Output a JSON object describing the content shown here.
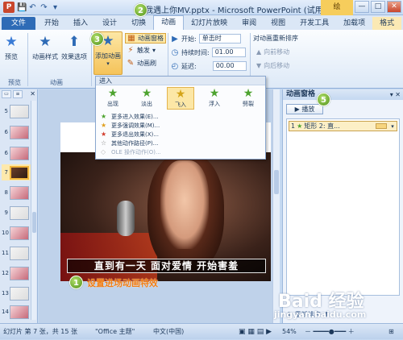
{
  "titlebar": {
    "app_logo": "P",
    "qat": [
      "💾",
      "↶",
      "↷",
      "▾"
    ],
    "title": "当我遇上你MV.pptx - Microsoft PowerPoint (试用版)",
    "context_tab": "绘",
    "win_btns": [
      "—",
      "□",
      "✕"
    ]
  },
  "tabs": [
    "文件",
    "开始",
    "插入",
    "设计",
    "切换",
    "动画",
    "幻灯片放映",
    "审阅",
    "视图",
    "开发工具",
    "加载项",
    "格式"
  ],
  "ribbon": {
    "preview": "预览",
    "anim_style": "动画样式",
    "effect_options": "效果选项",
    "add_anim": "添加动画",
    "anim_pane_btn": "动画窗格",
    "trigger": "触发",
    "anim_painter": "动画刷",
    "start_label": "开始:",
    "start_value": "单击时",
    "duration_label": "持续时间:",
    "duration_value": "01.00",
    "delay_label": "延迟:",
    "delay_value": "00.00",
    "reorder": "对动画重新排序",
    "move_earlier": "向前移动",
    "move_later": "向后移动",
    "grp_preview": "预览",
    "grp_animation": "动画"
  },
  "dropdown": {
    "header": "进入",
    "items": [
      {
        "label": "出现"
      },
      {
        "label": "淡出"
      },
      {
        "label": "飞入"
      },
      {
        "label": "浮入"
      },
      {
        "label": "劈裂"
      }
    ],
    "menu": [
      "更多进入效果(E)...",
      "更多强调效果(M)...",
      "更多退出效果(X)...",
      "其他动作路径(P)...",
      "OLE 操作动作(O)..."
    ]
  },
  "slides": [
    "5",
    "6",
    "7",
    "8",
    "9",
    "10",
    "11",
    "12",
    "13",
    "14"
  ],
  "slide": {
    "subtitle": "直到有一天 面对爱情 开始害羞",
    "caption": "设置进场动画特效"
  },
  "anim_pane": {
    "title": "动画窗格",
    "controls": "▾ ✕",
    "play": "▶ 播放",
    "item_num": "1",
    "item_text": "矩形 2: 直...",
    "footer_reorder": "重新排序"
  },
  "badges": [
    "1",
    "2",
    "3",
    "4",
    "5"
  ],
  "watermark": "Baid 经验",
  "watermark_sub": "jingyan.baidu.com",
  "status": {
    "slide_info": "幻灯片 第 7 张，共 15 张",
    "theme": "\"Office 主题\"",
    "lang": "中文(中国)",
    "zoom": "54%"
  }
}
